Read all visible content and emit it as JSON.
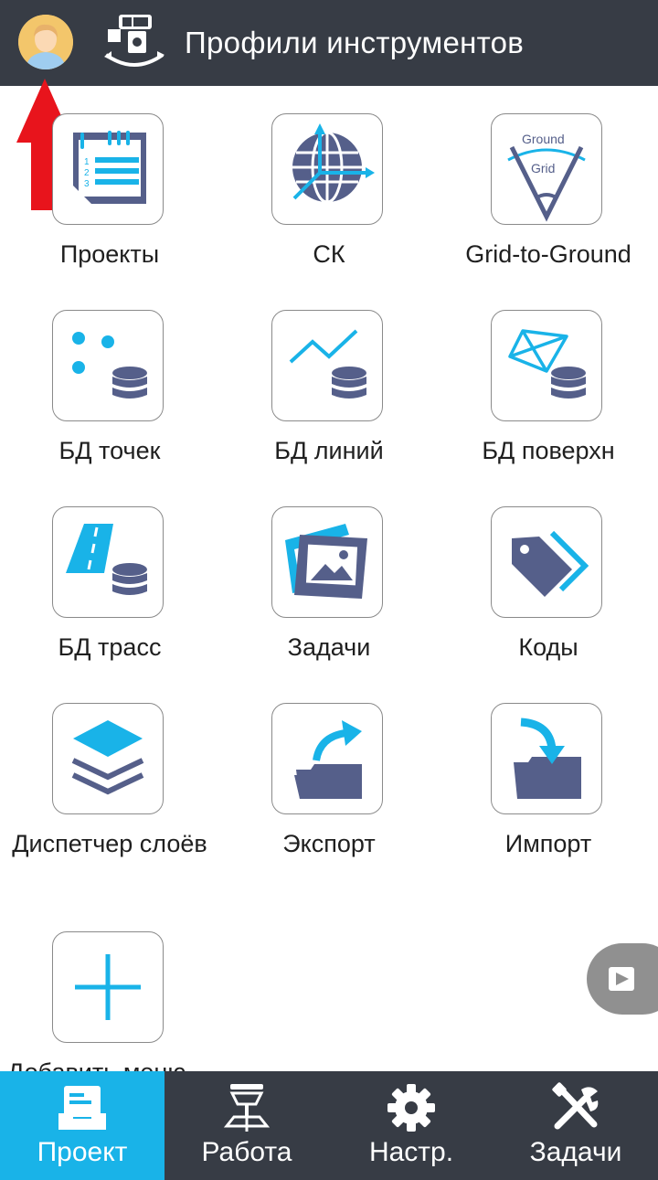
{
  "header": {
    "title": "Профили инструментов",
    "avatar_icon": "user-avatar-icon",
    "app_icon": "instrument-profile-icon"
  },
  "colors": {
    "header_bg": "#373c45",
    "accent": "#19b3e8",
    "icon_dark": "#555f8a",
    "arrow": "#e8141c"
  },
  "menu": [
    {
      "label": "Проекты",
      "icon": "projects-icon"
    },
    {
      "label": "СК",
      "icon": "coordinate-system-icon"
    },
    {
      "label": "Grid-to-Ground",
      "icon": "grid-to-ground-icon",
      "icon_text_top": "Ground",
      "icon_text_bottom": "Grid"
    },
    {
      "label": "БД точек",
      "icon": "points-database-icon"
    },
    {
      "label": "БД линий",
      "icon": "lines-database-icon"
    },
    {
      "label": "БД поверхн",
      "icon": "surfaces-database-icon"
    },
    {
      "label": "БД трасс",
      "icon": "roads-database-icon"
    },
    {
      "label": "Задачи",
      "icon": "tasks-images-icon"
    },
    {
      "label": "Коды",
      "icon": "codes-tag-icon"
    },
    {
      "label": "Диспетчер слоёв",
      "icon": "layers-icon"
    },
    {
      "label": "Экспорт",
      "icon": "export-folder-icon"
    },
    {
      "label": "Импорт",
      "icon": "import-folder-icon"
    },
    {
      "label": "Добавить меню",
      "icon": "add-plus-icon"
    }
  ],
  "bottom_nav": [
    {
      "label": "Проект",
      "icon": "project-tray-icon",
      "active": true
    },
    {
      "label": "Работа",
      "icon": "gnss-receiver-icon",
      "active": false
    },
    {
      "label": "Настр.",
      "icon": "gear-icon",
      "active": false
    },
    {
      "label": "Задачи",
      "icon": "tools-icon",
      "active": false
    }
  ]
}
